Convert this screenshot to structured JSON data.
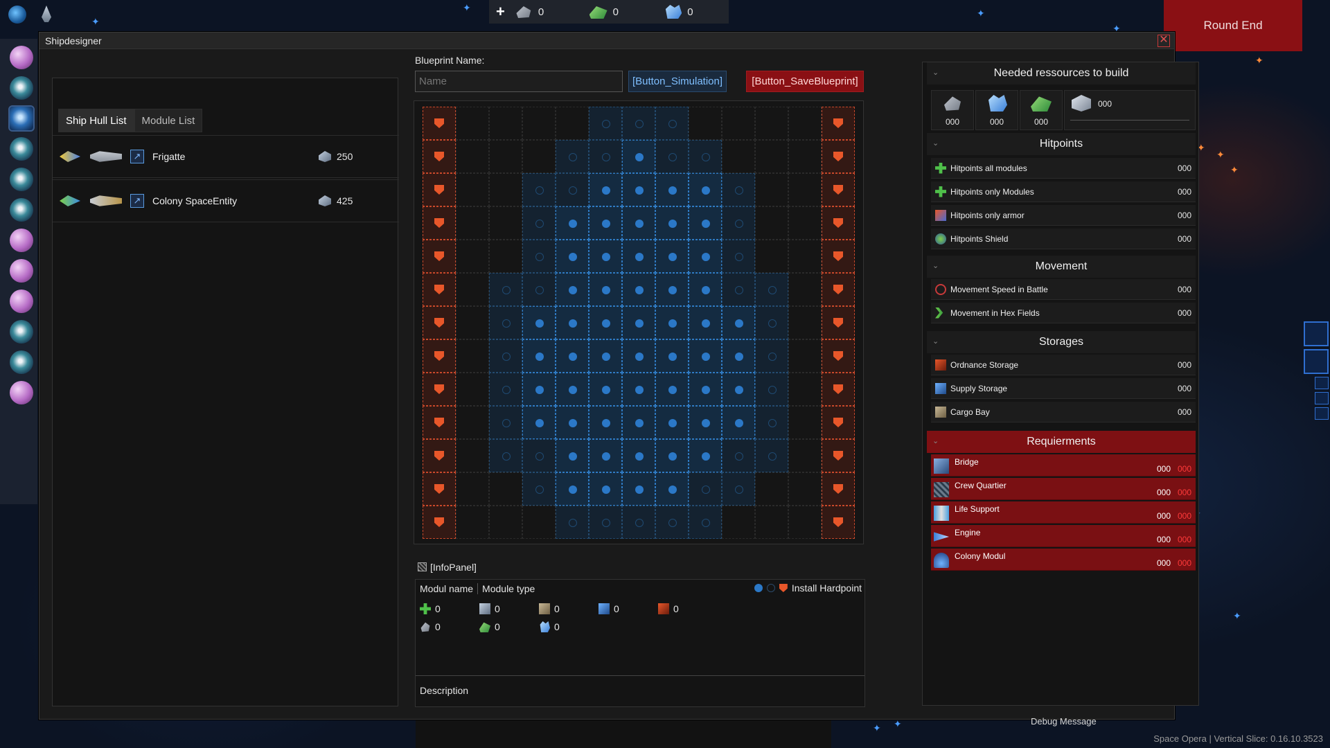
{
  "topbar": {
    "resources": [
      {
        "icon": "metal-icon",
        "value": "0"
      },
      {
        "icon": "organic-icon",
        "value": "0"
      },
      {
        "icon": "crystal-icon",
        "value": "0"
      }
    ],
    "round_end": "Round End"
  },
  "window": {
    "title": "Shipdesigner",
    "close": "✕"
  },
  "hull_panel": {
    "tabs": [
      "Ship Hull List",
      "Module List"
    ],
    "hulls": [
      {
        "name": "Frigatte",
        "cost": "250"
      },
      {
        "name": "Colony SpaceEntity",
        "cost": "425"
      }
    ]
  },
  "blueprint": {
    "label": "Blueprint Name:",
    "name_placeholder": "Name",
    "simulation_button": "[Button_Simulation]",
    "save_button": "[Button_SaveBlueprint]"
  },
  "info_panel": {
    "title": "[InfoPanel]",
    "col_name": "Modul name",
    "col_type": "Module type",
    "install_label": "Install Hardpoint",
    "row1": [
      "0",
      "0",
      "0",
      "0",
      "0"
    ],
    "row2": [
      "0",
      "0",
      "0"
    ],
    "description": "Description"
  },
  "stats": {
    "needed_title": "Needed ressources to build",
    "needed_values": [
      "000",
      "000",
      "000"
    ],
    "needed_extra": "000",
    "hitpoints_title": "Hitpoints",
    "hitpoints": [
      {
        "label": "Hitpoints all modules",
        "value": "000"
      },
      {
        "label": "Hitpoints only Modules",
        "value": "000"
      },
      {
        "label": "Hitpoints only armor",
        "value": "000"
      },
      {
        "label": "Hitpoints Shield",
        "value": "000"
      }
    ],
    "movement_title": "Movement",
    "movement": [
      {
        "label": "Movement Speed in Battle",
        "value": "000"
      },
      {
        "label": "Movement in Hex Fields",
        "value": "000"
      }
    ],
    "storages_title": "Storages",
    "storages": [
      {
        "label": "Ordnance Storage",
        "value": "000"
      },
      {
        "label": "Supply Storage",
        "value": "000"
      },
      {
        "label": "Cargo Bay",
        "value": "000"
      }
    ],
    "requirements_title": "Requierments",
    "requirements": [
      {
        "label": "Bridge",
        "value": "000",
        "required": "000"
      },
      {
        "label": "Crew Quartier",
        "value": "000",
        "required": "000"
      },
      {
        "label": "Life Support",
        "value": "000",
        "required": "000"
      },
      {
        "label": "Engine",
        "value": "000",
        "required": "000"
      },
      {
        "label": "Colony Modul",
        "value": "000",
        "required": "000"
      }
    ]
  },
  "footer": {
    "debug": "Debug Message",
    "version": "Space Opera | Vertical Slice: 0.16.10.3523"
  }
}
